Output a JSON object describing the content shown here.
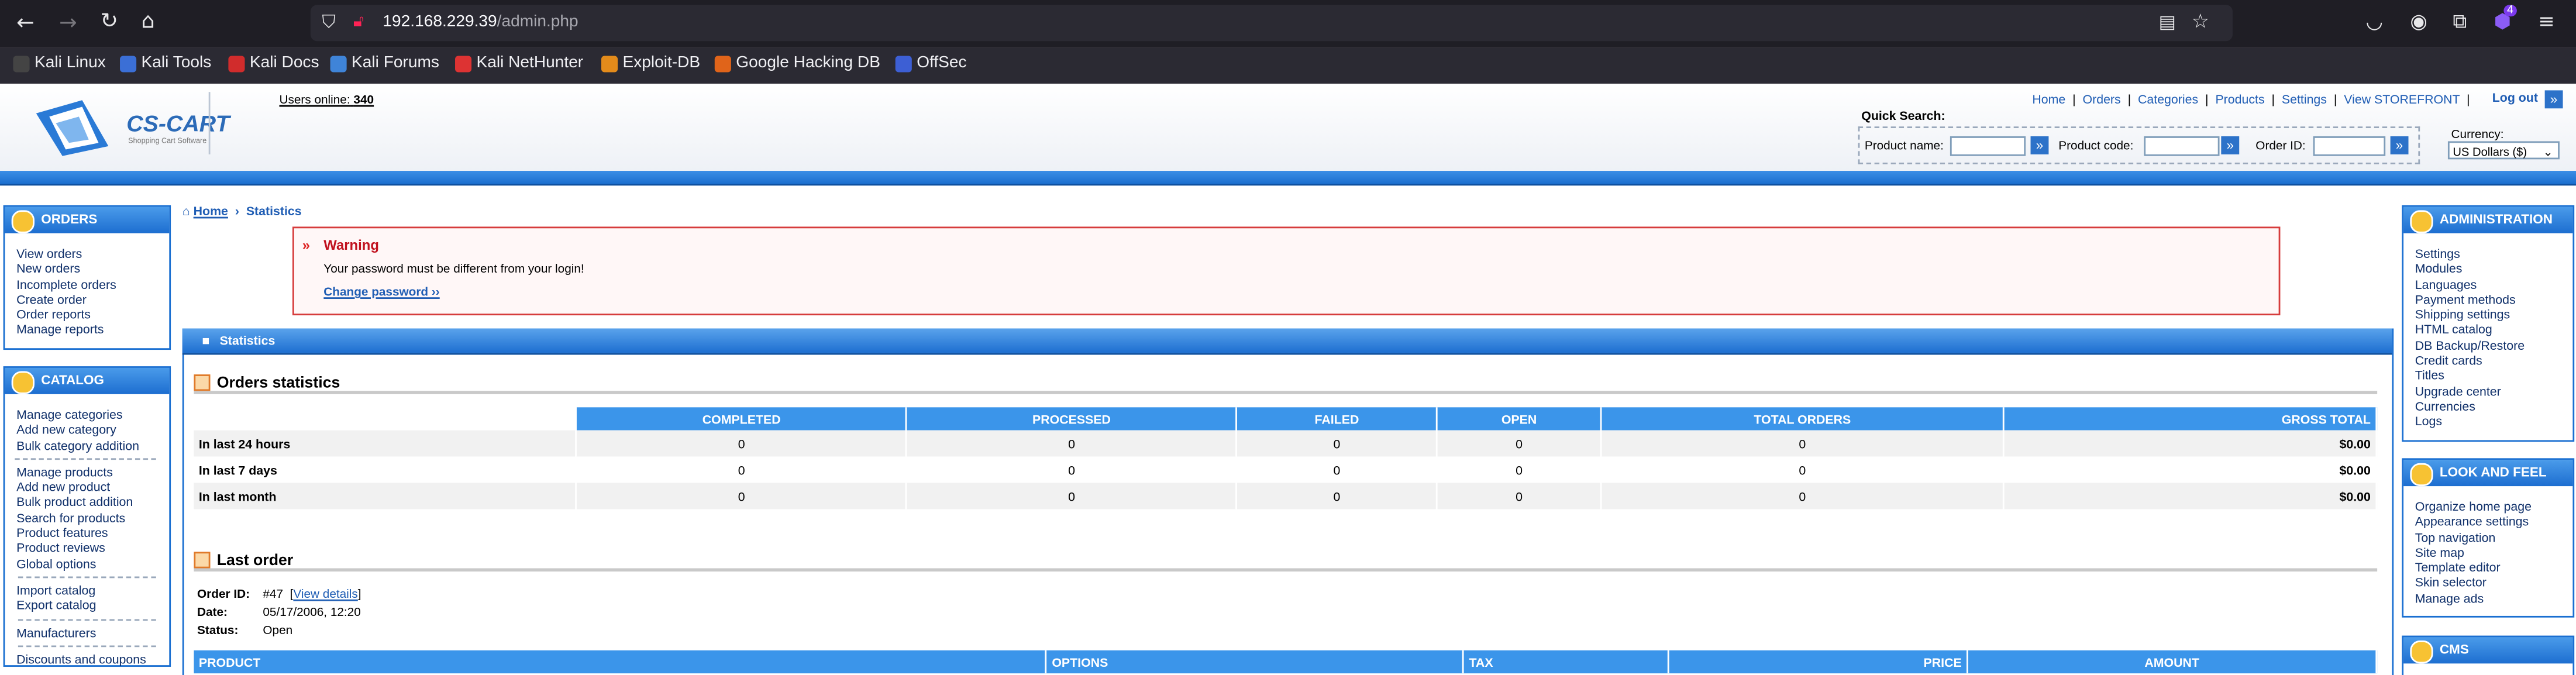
{
  "browser": {
    "url_host": "192.168.229.39",
    "url_path": "/admin.php",
    "ext_badge": "4",
    "bookmarks": [
      "Kali Linux",
      "Kali Tools",
      "Kali Docs",
      "Kali Forums",
      "Kali NetHunter",
      "Exploit-DB",
      "Google Hacking DB",
      "OffSec"
    ],
    "icons": [
      "back-icon",
      "forward-icon",
      "reload-icon",
      "home-icon",
      "shield-icon",
      "lock-icon",
      "reader-icon",
      "star-icon",
      "pocket-icon",
      "account-icon",
      "extensions-icon",
      "menu-icon"
    ]
  },
  "header": {
    "logo": "CS-CART",
    "logo_sub": "Shopping Cart Software",
    "users_online_label": "Users online:",
    "users_online": "340",
    "top_links": [
      "Home",
      "Orders",
      "Categories",
      "Products",
      "Settings",
      "View STOREFRONT"
    ],
    "logout": "Log out",
    "quick_search": "Quick Search:",
    "product_name": "Product name:",
    "product_code": "Product code:",
    "order_id": "Order ID:",
    "currency_label": "Currency:",
    "currency": "US Dollars ($)"
  },
  "left": {
    "orders": {
      "title": "ORDERS",
      "items": [
        "View orders",
        "New orders",
        "Incomplete orders",
        "Create order",
        "Order reports",
        "Manage reports"
      ]
    },
    "catalog": {
      "title": "CATALOG",
      "g1": [
        "Manage categories",
        "Add new category",
        "Bulk category addition"
      ],
      "g2": [
        "Manage products",
        "Add new product",
        "Bulk product addition",
        "Search for products",
        "Product features",
        "Product reviews",
        "Global options"
      ],
      "g3": [
        "Import catalog",
        "Export catalog"
      ],
      "g4": [
        "Manufacturers"
      ],
      "g5": [
        "Discounts and coupons"
      ]
    }
  },
  "right": {
    "admin": {
      "title": "ADMINISTRATION",
      "items": [
        "Settings",
        "Modules",
        "Languages",
        "Payment methods",
        "Shipping settings",
        "HTML catalog",
        "DB Backup/Restore",
        "Credit cards",
        "Titles",
        "Upgrade center",
        "Currencies",
        "Logs"
      ]
    },
    "look": {
      "title": "LOOK AND FEEL",
      "items": [
        "Organize home page",
        "Appearance settings",
        "Top navigation",
        "Site map",
        "Template editor",
        "Skin selector",
        "Manage ads"
      ]
    },
    "cms": {
      "title": "CMS"
    }
  },
  "breadcrumb": {
    "home": "Home",
    "current": "Statistics"
  },
  "warning": {
    "title": "Warning",
    "text": "Your password must be different from your login!",
    "link": "Change password ››"
  },
  "stats": {
    "title": "Statistics",
    "orders_title": "Orders statistics",
    "columns": [
      "",
      "COMPLETED",
      "PROCESSED",
      "FAILED",
      "OPEN",
      "TOTAL ORDERS",
      "GROSS TOTAL"
    ],
    "rows": [
      [
        "In last 24 hours",
        "0",
        "0",
        "0",
        "0",
        "0",
        "$0.00"
      ],
      [
        "In last 7 days",
        "0",
        "0",
        "0",
        "0",
        "0",
        "$0.00"
      ],
      [
        "In last month",
        "0",
        "0",
        "0",
        "0",
        "0",
        "$0.00"
      ]
    ]
  },
  "last_order": {
    "title": "Last order",
    "order_id_label": "Order ID:",
    "order_id": "#47",
    "view_details": "View details",
    "date_label": "Date:",
    "date": "05/17/2006, 12:20",
    "status_label": "Status:",
    "status": "Open",
    "columns": [
      "PRODUCT",
      "OPTIONS",
      "TAX",
      "PRICE",
      "AMOUNT"
    ]
  }
}
